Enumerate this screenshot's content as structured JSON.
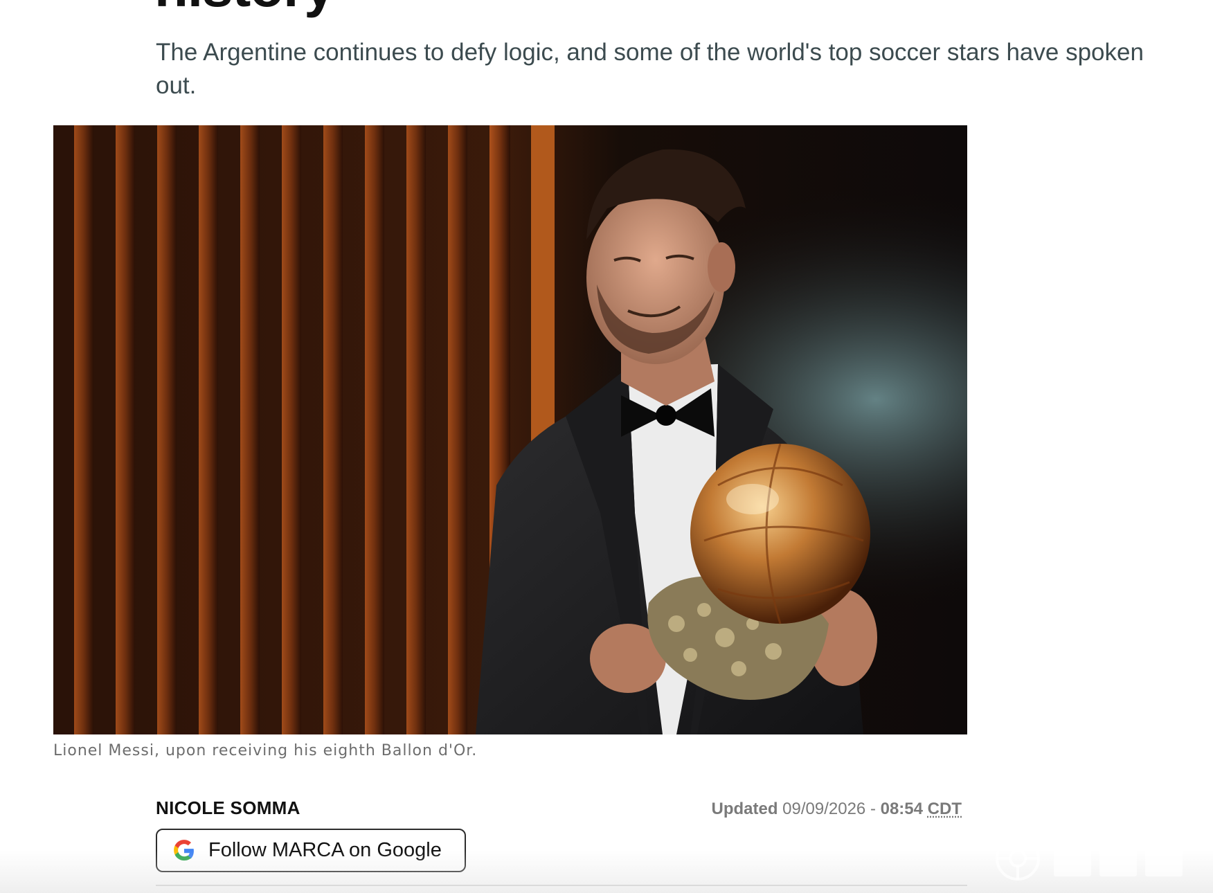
{
  "article": {
    "headline_tail": "history",
    "subheadline": "The Argentine continues to defy logic, and some of the world's top soccer stars have spoken out.",
    "photo_caption": "Lionel Messi, upon receiving his eighth Ballon d'Or.",
    "byline": {
      "author": "NICOLE SOMMA",
      "updated_label": "Updated",
      "date": "09/09/2026",
      "separator": " - ",
      "time": "08:54",
      "timezone": "CDT"
    },
    "follow_button": {
      "label": "Follow MARCA on Google",
      "icon": "google-g-icon"
    }
  },
  "colors": {
    "subheadline": "#3c4b4f",
    "caption": "#6d6d6d",
    "meta": "#7a7a7a",
    "button_border": "#2c2c2c"
  }
}
